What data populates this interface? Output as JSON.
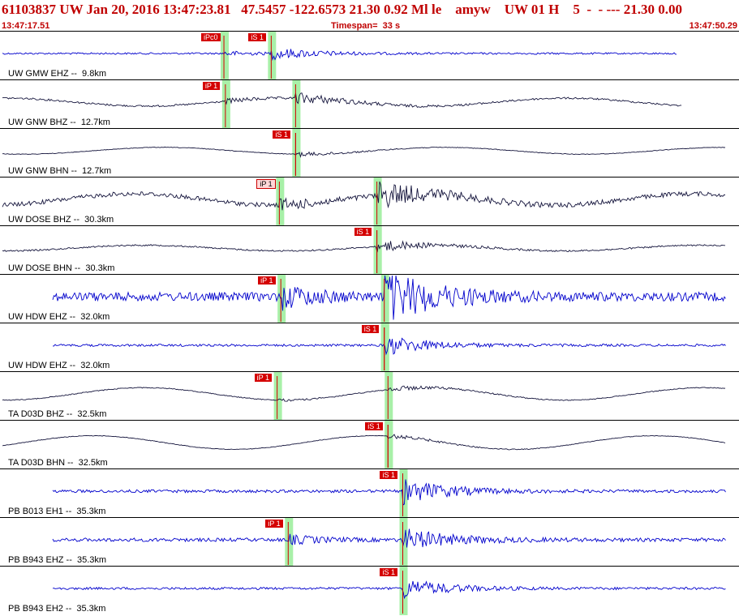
{
  "header": {
    "title": "61103837 UW Jan 20, 2016 13:47:23.81   47.5457 -122.6573 21.30 0.92 Ml le    amyw    UW 01 H    5  -  - --- 21.30 0.00",
    "start_time": "13:47:17.51",
    "timespan": "Timespan=  33 s",
    "end_time": "13:47:50.29"
  },
  "colors": {
    "trace_blue": "#0000cc",
    "trace_dark": "#14143c",
    "pick_red": "#d40000",
    "window_green": "#a8f0a8"
  },
  "channels": [
    {
      "label": "UW GMW EHZ --  9.8km",
      "color": "blue",
      "pick": {
        "text": "iPc0",
        "t": 0.303
      },
      "spick": {
        "text": "iS 1",
        "t": 0.367
      },
      "lf": 0.0,
      "amp": 0.06
    },
    {
      "label": "UW GNW BHZ --  12.7km",
      "color": "dark",
      "pick": {
        "text": "iP 1",
        "t": 0.305
      },
      "spick": {
        "text": "",
        "t": 0.4
      },
      "lf": 0.35,
      "amp": 0.06
    },
    {
      "label": "UW GNW BHN --  12.7km",
      "color": "dark",
      "pick": {
        "text": "iS 1",
        "t": 0.4
      },
      "spick": {
        "text": "",
        "t": 0.4
      },
      "lf": 0.3,
      "amp": 0.02
    },
    {
      "label": "UW DOSE BHZ --  30.3km",
      "color": "dark",
      "pick": {
        "text": "iP 1",
        "t": 0.378,
        "light": true
      },
      "spick": {
        "text": "",
        "t": 0.51
      },
      "lf": 0.5,
      "amp": 0.15
    },
    {
      "label": "UW DOSE BHN --  30.3km",
      "color": "dark",
      "pick": {
        "text": "iS 1",
        "t": 0.51
      },
      "spick": {
        "text": "",
        "t": 0.51
      },
      "lf": 0.25,
      "amp": 0.05
    },
    {
      "label": "UW HDW EHZ --  32.0km",
      "color": "blue",
      "pick": {
        "text": "iP 1",
        "t": 0.38
      },
      "spick": {
        "text": "",
        "t": 0.52
      },
      "lf": 0.0,
      "amp": 0.3
    },
    {
      "label": "UW HDW EHZ --  32.0km",
      "color": "blue",
      "pick": {
        "text": "iS 1",
        "t": 0.52
      },
      "spick": {
        "text": "",
        "t": 0.52
      },
      "lf": 0.0,
      "amp": 0.08
    },
    {
      "label": "TA D03D BHZ --  32.5km",
      "color": "dark",
      "pick": {
        "text": "iP 1",
        "t": 0.375
      },
      "spick": {
        "text": "",
        "t": 0.525
      },
      "lf": 0.55,
      "amp": 0.03
    },
    {
      "label": "TA D03D BHN --  32.5km",
      "color": "dark",
      "pick": {
        "text": "iS 1",
        "t": 0.525
      },
      "spick": {
        "text": "",
        "t": 0.525
      },
      "lf": 0.6,
      "amp": 0.02
    },
    {
      "label": "PB B013 EH1 --  35.3km",
      "color": "blue",
      "pick": {
        "text": "iS 1",
        "t": 0.545
      },
      "spick": {
        "text": "",
        "t": 0.545
      },
      "lf": 0.0,
      "amp": 0.1
    },
    {
      "label": "PB B943 EHZ --  35.3km",
      "color": "blue",
      "pick": {
        "text": "iP 1",
        "t": 0.39
      },
      "spick": {
        "text": "",
        "t": 0.545
      },
      "lf": 0.0,
      "amp": 0.12
    },
    {
      "label": "PB B943 EH2 --  35.3km",
      "color": "blue",
      "pick": {
        "text": "iS 1",
        "t": 0.545
      },
      "spick": {
        "text": "",
        "t": 0.545
      },
      "lf": 0.0,
      "amp": 0.08
    }
  ]
}
